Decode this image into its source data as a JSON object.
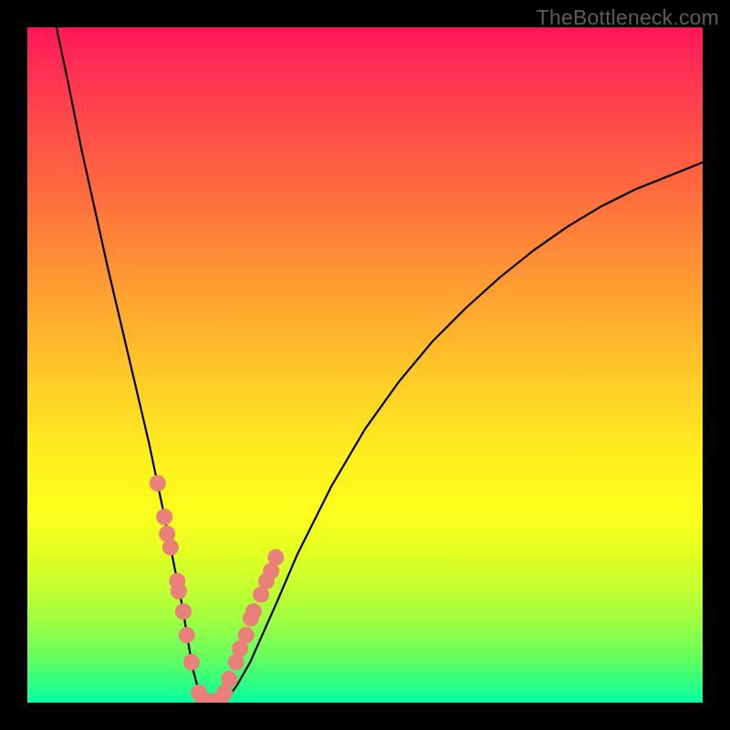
{
  "attribution": "TheBottleneck.com",
  "colors": {
    "page_bg": "#000000",
    "curve_stroke": "#000000",
    "marker_fill": "#e98079",
    "marker_stroke": "#cf5e57",
    "attribution_text": "#5c5c5c"
  },
  "chart_data": {
    "type": "line",
    "title": "",
    "xlabel": "",
    "ylabel": "",
    "xlim": [
      0,
      100
    ],
    "ylim": [
      0,
      100
    ],
    "grid": false,
    "legend": false,
    "note": "x spans the plot interior left→right; y is bottleneck % (0 = none, plotted at bottom). Values estimated from pixel positions against the 740px-square plot area; no axis ticks are shown in the source image.",
    "series": [
      {
        "name": "bottleneck_curve",
        "x": [
          4.3,
          6,
          8,
          10,
          12,
          14,
          16,
          18,
          20,
          21,
          22,
          23,
          23.8,
          24.5,
          25.3,
          26,
          27,
          28,
          29.5,
          31,
          33,
          35,
          37,
          40,
          45,
          50,
          55,
          60,
          65,
          70,
          75,
          80,
          85,
          90,
          95,
          100
        ],
        "y": [
          100,
          92,
          82,
          73,
          64,
          55.5,
          47,
          38.5,
          29,
          24,
          19,
          14,
          9,
          5,
          2,
          0.5,
          0,
          0,
          0.5,
          2.5,
          6,
          10.5,
          15,
          22,
          32,
          40.5,
          47.5,
          53.5,
          58.5,
          63,
          67,
          70.5,
          73.5,
          76,
          78,
          80
        ]
      }
    ],
    "markers": {
      "name": "sample_points",
      "x": [
        19.3,
        20.3,
        20.7,
        21.2,
        22.2,
        22.4,
        23.1,
        23.6,
        24.3,
        25.4,
        26.0,
        27.6,
        28.6,
        29.2,
        29.9,
        30.9,
        31.5,
        32.4,
        33.1,
        33.5,
        34.6,
        35.4,
        36.1,
        36.8
      ],
      "y": [
        32.5,
        27.5,
        25.0,
        23.0,
        18.0,
        16.5,
        13.5,
        10.0,
        6.0,
        1.5,
        0.5,
        0.2,
        0.5,
        1.5,
        3.5,
        6.0,
        8.0,
        10.0,
        12.5,
        13.5,
        16.0,
        18.0,
        19.5,
        21.5
      ]
    }
  }
}
